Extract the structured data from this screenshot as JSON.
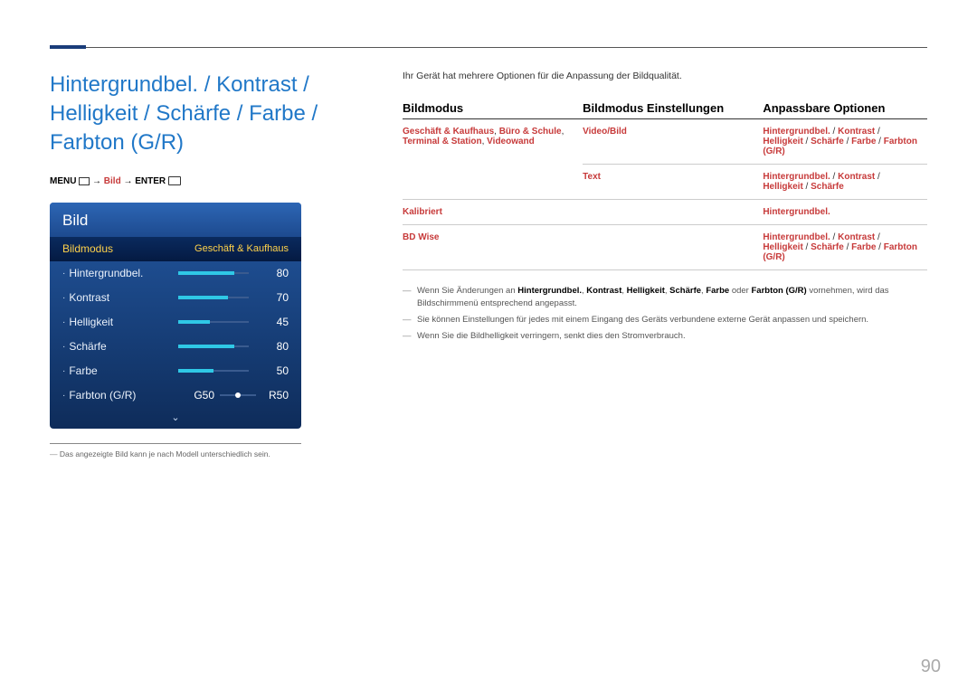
{
  "page_number": "90",
  "title": "Hintergrundbel. / Kontrast / Helligkeit / Schärfe / Farbe / Farbton (G/R)",
  "breadcrumb": {
    "menu": "MENU",
    "arrow": " → ",
    "bild": "Bild",
    "enter": "ENTER"
  },
  "osd": {
    "header": "Bild",
    "mode_label": "Bildmodus",
    "mode_value": "Geschäft & Kaufhaus",
    "rows": [
      {
        "label": "Hintergrundbel.",
        "value": "80",
        "pct": 80
      },
      {
        "label": "Kontrast",
        "value": "70",
        "pct": 70
      },
      {
        "label": "Helligkeit",
        "value": "45",
        "pct": 45
      },
      {
        "label": "Schärfe",
        "value": "80",
        "pct": 80
      },
      {
        "label": "Farbe",
        "value": "50",
        "pct": 50
      }
    ],
    "tint": {
      "label": "Farbton (G/R)",
      "g": "G50",
      "r": "R50"
    },
    "chevron": "⌄"
  },
  "footnote_image": "Das angezeigte Bild kann je nach Modell unterschiedlich sein.",
  "intro": "Ihr Gerät hat mehrere Optionen für die Anpassung der Bildqualität.",
  "table": {
    "h1": "Bildmodus",
    "h2": "Bildmodus Einstellungen",
    "h3": "Anpassbare Optionen",
    "rows": [
      {
        "c1": [
          {
            "t": "Geschäft & Kaufhaus",
            "s": "strong"
          },
          {
            "t": ", ",
            "s": "sep"
          },
          {
            "t": "Büro & Schule",
            "s": "strong"
          },
          {
            "t": ",  ",
            "s": "sep"
          },
          {
            "t": "Terminal & Station",
            "s": "strong"
          },
          {
            "t": ", ",
            "s": "sep"
          },
          {
            "t": "Videowand",
            "s": "strong"
          }
        ],
        "c2": [
          {
            "t": "Video/Bild",
            "s": "strong"
          }
        ],
        "c3": [
          {
            "t": "Hintergrundbel.",
            "s": "strong"
          },
          {
            "t": " / ",
            "s": "sep"
          },
          {
            "t": "Kontrast",
            "s": "strong"
          },
          {
            "t": " / ",
            "s": "sep"
          },
          {
            "t": "Helligkeit",
            "s": "strong"
          },
          {
            "t": " / ",
            "s": "sep"
          },
          {
            "t": "Schärfe",
            "s": "strong"
          },
          {
            "t": " / ",
            "s": "sep"
          },
          {
            "t": "Farbe",
            "s": "strong"
          },
          {
            "t": " / ",
            "s": "sep"
          },
          {
            "t": "Farbton (G/R)",
            "s": "strong"
          }
        ]
      },
      {
        "c1": [],
        "c2": [
          {
            "t": "Text",
            "s": "strong"
          }
        ],
        "c3": [
          {
            "t": "Hintergrundbel.",
            "s": "strong"
          },
          {
            "t": " / ",
            "s": "sep"
          },
          {
            "t": "Kontrast",
            "s": "strong"
          },
          {
            "t": " / ",
            "s": "sep"
          },
          {
            "t": "Helligkeit",
            "s": "strong"
          },
          {
            "t": " / ",
            "s": "sep"
          },
          {
            "t": "Schärfe",
            "s": "strong"
          }
        ]
      },
      {
        "c1": [
          {
            "t": "Kalibriert",
            "s": "strong"
          }
        ],
        "c2": [],
        "c3": [
          {
            "t": "Hintergrundbel.",
            "s": "strong"
          }
        ]
      },
      {
        "c1": [
          {
            "t": "BD Wise",
            "s": "strong"
          }
        ],
        "c2": [],
        "c3": [
          {
            "t": "Hintergrundbel.",
            "s": "strong"
          },
          {
            "t": " / ",
            "s": "sep"
          },
          {
            "t": "Kontrast",
            "s": "strong"
          },
          {
            "t": " / ",
            "s": "sep"
          },
          {
            "t": "Helligkeit",
            "s": "strong"
          },
          {
            "t": " / ",
            "s": "sep"
          },
          {
            "t": "Schärfe",
            "s": "strong"
          },
          {
            "t": " / ",
            "s": "sep"
          },
          {
            "t": "Farbe",
            "s": "strong"
          },
          {
            "t": " / ",
            "s": "sep"
          },
          {
            "t": "Farbton (G/R)",
            "s": "strong"
          }
        ]
      }
    ]
  },
  "notes": {
    "n1_parts": [
      {
        "t": "Wenn Sie Änderungen an ",
        "s": "plain"
      },
      {
        "t": "Hintergrundbel.",
        "s": "strong"
      },
      {
        "t": ", ",
        "s": "plain"
      },
      {
        "t": "Kontrast",
        "s": "strong"
      },
      {
        "t": ", ",
        "s": "plain"
      },
      {
        "t": "Helligkeit",
        "s": "strong"
      },
      {
        "t": ", ",
        "s": "plain"
      },
      {
        "t": "Schärfe",
        "s": "strong"
      },
      {
        "t": ", ",
        "s": "plain"
      },
      {
        "t": "Farbe",
        "s": "strong"
      },
      {
        "t": " oder ",
        "s": "plain"
      },
      {
        "t": "Farbton (G/R)",
        "s": "strong"
      },
      {
        "t": " vornehmen, wird das Bildschirmmenü entsprechend angepasst.",
        "s": "plain"
      }
    ],
    "n2": "Sie können Einstellungen für jedes mit einem Eingang des Geräts verbundene externe Gerät anpassen und speichern.",
    "n3": "Wenn Sie die Bildhelligkeit verringern, senkt dies den Stromverbrauch."
  }
}
